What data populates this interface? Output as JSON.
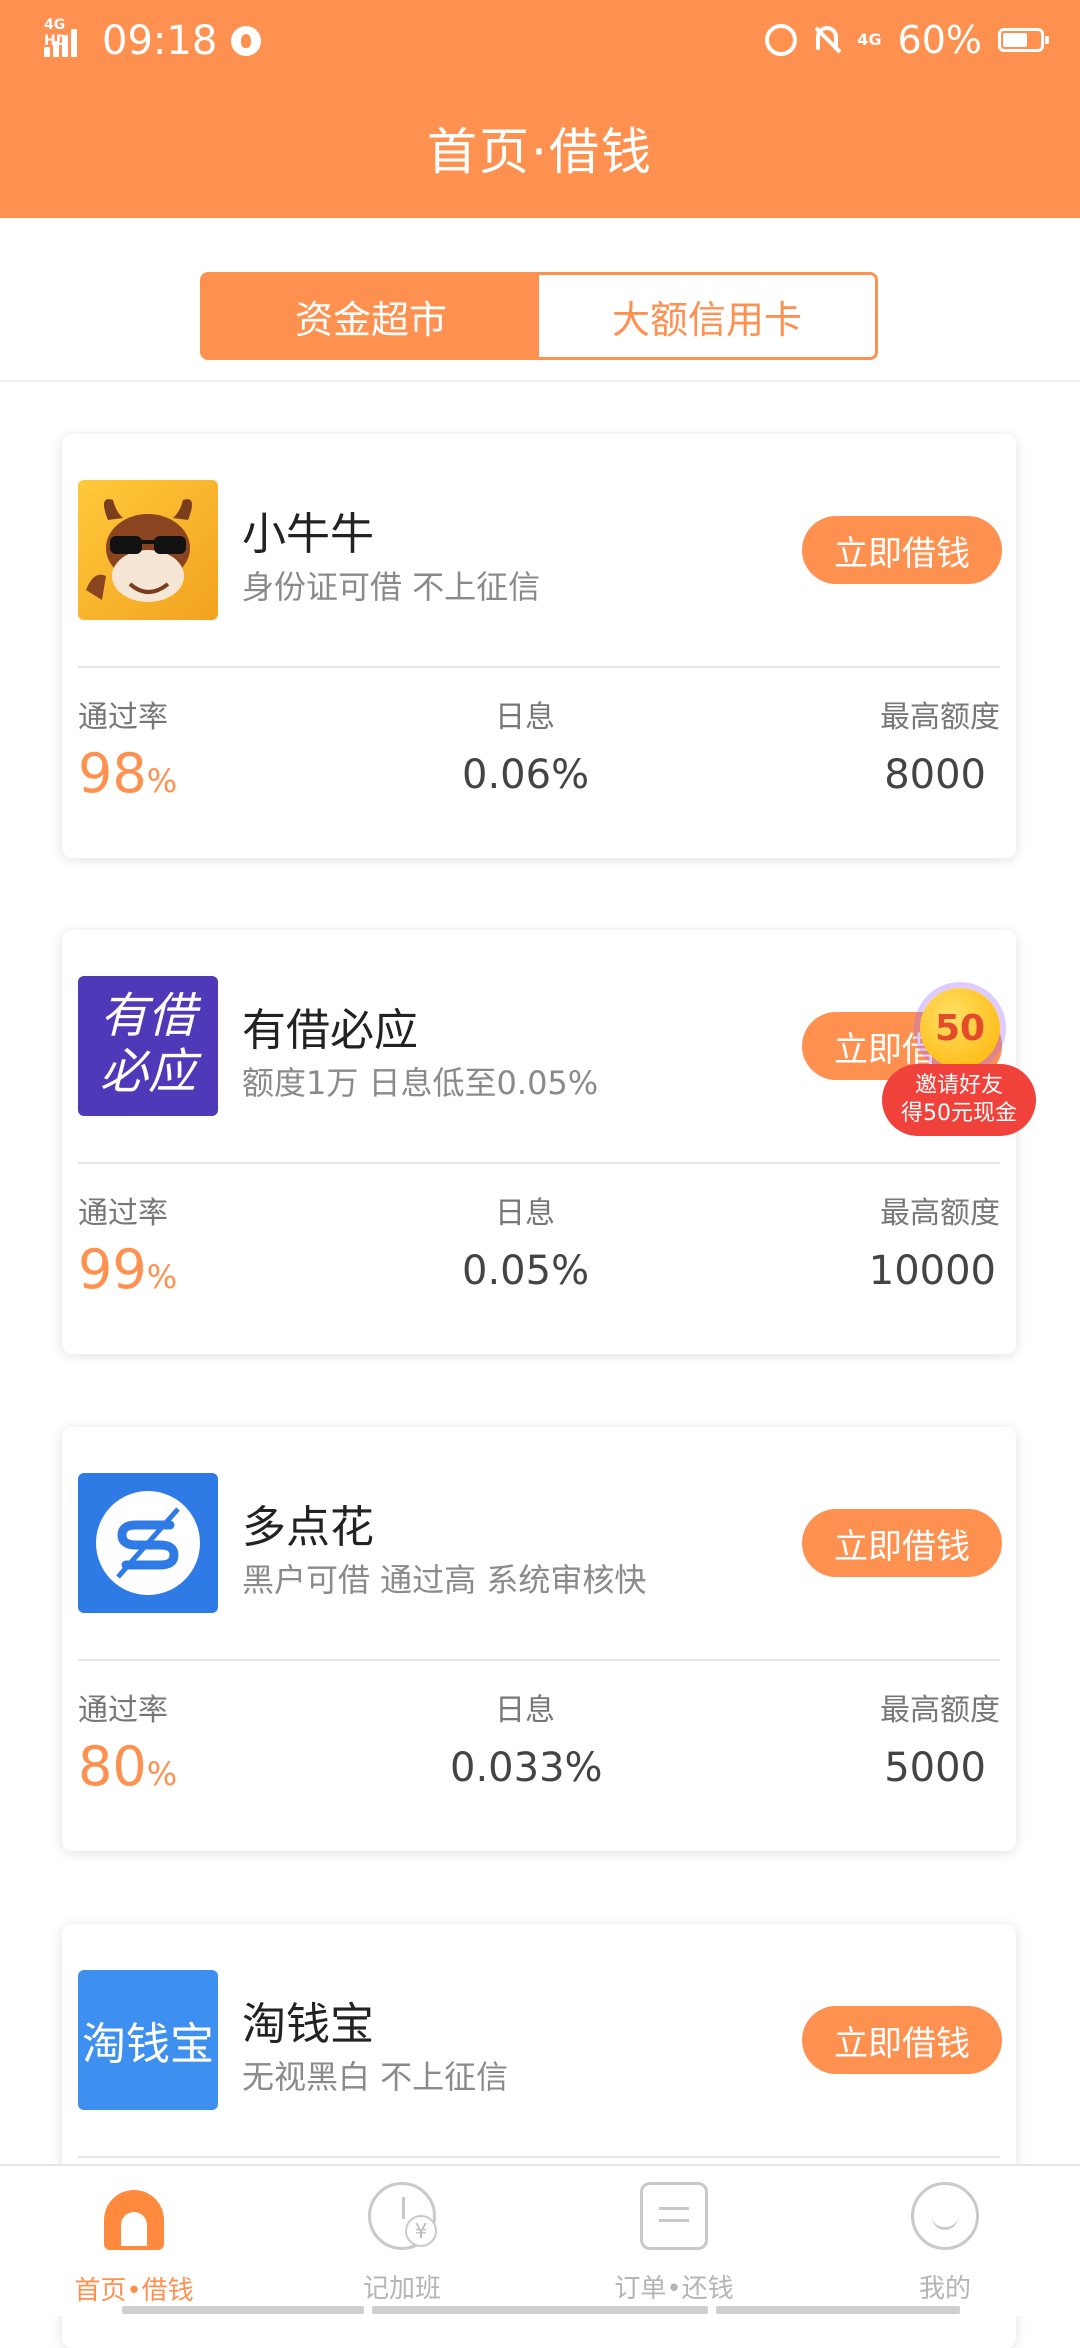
{
  "status": {
    "network_label": "4G HD",
    "time": "09:18",
    "net_right": "4G",
    "battery": "60%"
  },
  "header": {
    "title": "首页·借钱"
  },
  "tabs": [
    {
      "label": "资金超市"
    },
    {
      "label": "大额信用卡"
    }
  ],
  "stat_labels": {
    "pass_rate": "通过率",
    "daily_interest": "日息",
    "max_amount": "最高额度"
  },
  "cards": [
    {
      "name": "小牛牛",
      "desc": "身份证可借 不上征信",
      "button": "立即借钱",
      "pass_rate": "98",
      "pct": "%",
      "daily_interest": "0.06%",
      "max_amount": "8000",
      "logo": "bull-mascot"
    },
    {
      "name": "有借必应",
      "desc": "额度1万 日息低至0.05%",
      "button": "立即借钱",
      "pass_rate": "99",
      "pct": "%",
      "daily_interest": "0.05%",
      "max_amount": "10000",
      "logo": "有借必应",
      "logo_text": "有借\n必应"
    },
    {
      "name": "多点花",
      "desc": "黑户可借 通过高 系统审核快",
      "button": "立即借钱",
      "pass_rate": "80",
      "pct": "%",
      "daily_interest": "0.033%",
      "max_amount": "5000",
      "logo": "duodianhua-s"
    },
    {
      "name": "淘钱宝",
      "desc": "无视黑白 不上征信",
      "button": "立即借钱",
      "logo": "淘钱宝",
      "logo_text": "淘钱宝"
    }
  ],
  "invite": {
    "coin": "50",
    "line1": "邀请好友",
    "line2": "得50元现金"
  },
  "nav": [
    {
      "label": "首页•借钱",
      "icon": "home-icon",
      "active": true
    },
    {
      "label": "记加班",
      "icon": "clock-yuan-icon",
      "active": false
    },
    {
      "label": "订单•还钱",
      "icon": "order-icon",
      "active": false
    },
    {
      "label": "我的",
      "icon": "smile-icon",
      "active": false
    }
  ],
  "colors": {
    "accent": "#ff9150",
    "invite_red": "#f0413b",
    "logo_purple": "#4f39b8",
    "logo_blue": "#2f7be6"
  }
}
